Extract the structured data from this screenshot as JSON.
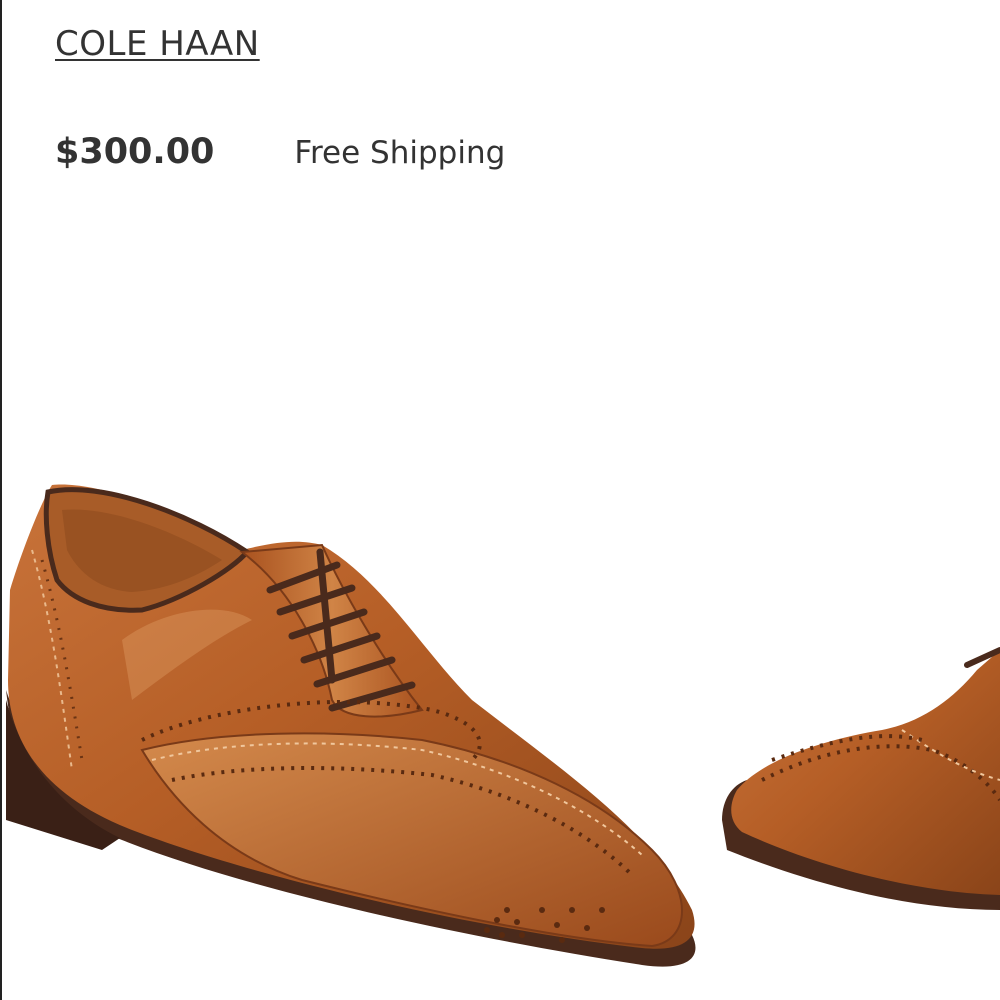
{
  "product": {
    "brand": "COLE HAAN",
    "price": "$300.00",
    "shipping": "Free Shipping",
    "image_alt": "Cole Haan brown leather wingtip oxford shoes",
    "colors": {
      "text": "#333333",
      "leather": "#b8622a",
      "leather_dark": "#7a3a18",
      "sole": "#4a2a1c"
    }
  }
}
